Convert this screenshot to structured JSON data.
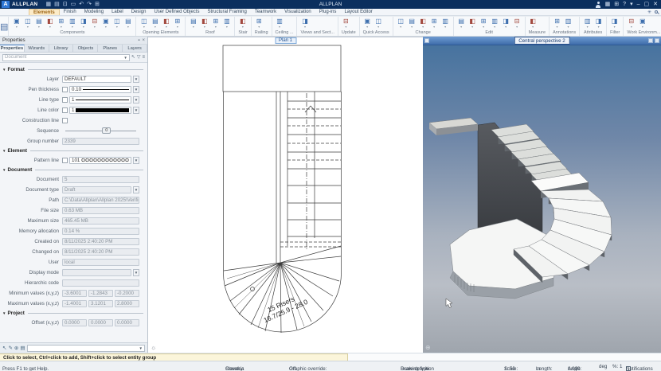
{
  "title_bar": {
    "app_name": "ALLPLAN",
    "logo_letter": "A",
    "center_title": "ALLPLAN",
    "qat_icons": [
      {
        "name": "menu-icon",
        "glyph": "▦"
      },
      {
        "name": "new-document-icon",
        "glyph": "▤"
      },
      {
        "name": "open-icon",
        "glyph": "⊡"
      },
      {
        "name": "save-icon",
        "glyph": "▭"
      },
      {
        "name": "undo-icon",
        "glyph": "↶"
      },
      {
        "name": "redo-icon",
        "glyph": "↷"
      },
      {
        "name": "print-icon",
        "glyph": "⊞"
      }
    ],
    "window_icons": {
      "apps": "▦",
      "cart": "⊞",
      "help": "?",
      "help_caret": "▾",
      "minimize": "–",
      "restore": "▢",
      "close": "✕"
    }
  },
  "ribbon": {
    "active_tab": "Elements",
    "tabs": [
      "Elements",
      "Finish",
      "Modeling",
      "Label",
      "Design",
      "User Defined Objects",
      "Structural Framing",
      "Teamwork",
      "Visualization",
      "Plug-ins",
      "Layout Editor"
    ],
    "groups": [
      {
        "label": "Components",
        "n": 11
      },
      {
        "label": "Opening Elements",
        "n": 4
      },
      {
        "label": "Roof",
        "n": 4
      },
      {
        "label": "Stair",
        "n": 1
      },
      {
        "label": "Railing",
        "n": 1
      },
      {
        "label": "Ceiling ...",
        "n": 1
      },
      {
        "label": "Views and Sect...",
        "n": 1
      },
      {
        "label": "Update",
        "n": 1
      },
      {
        "label": "Quick Access",
        "n": 2
      },
      {
        "label": "Change",
        "n": 5
      },
      {
        "label": "Edit",
        "n": 6
      },
      {
        "label": "Measure",
        "n": 1
      },
      {
        "label": "Annotations",
        "n": 2
      },
      {
        "label": "Attributes",
        "n": 2
      },
      {
        "label": "Filter",
        "n": 1
      },
      {
        "label": "Work Environm...",
        "n": 2
      }
    ]
  },
  "panel": {
    "title": "Properties",
    "tabs": [
      "Properties",
      "Wizards",
      "Library",
      "Objects",
      "Planes",
      "Layers"
    ],
    "active_tab": "Properties",
    "filter_placeholder": "Document",
    "sections": {
      "format": {
        "title": "Format",
        "layer_label": "Layer",
        "layer_value": "DEFAULT",
        "pen_label": "Pen thickness",
        "pen_value": "0.10",
        "linetype_label": "Line type",
        "linetype_value": "1",
        "linecolor_label": "Line color",
        "linecolor_value": "1",
        "construction_label": "Construction line",
        "sequence_label": "Sequence",
        "sequence_value": "0",
        "group_label": "Group number",
        "group_value": "2339"
      },
      "element": {
        "title": "Element",
        "pattern_label": "Pattern line",
        "pattern_value": "101"
      },
      "document": {
        "title": "Document",
        "rows": [
          {
            "label": "Document",
            "value": "5"
          },
          {
            "label": "Document type",
            "value": "Draft",
            "kind": "select"
          },
          {
            "label": "Path",
            "value": "C:\\Data\\Allplan\\Allplan 2025\\Verification"
          },
          {
            "label": "File size",
            "value": "0.63 MB"
          },
          {
            "label": "Maximum size",
            "value": "465.45 MB"
          },
          {
            "label": "Memory allocation",
            "value": "0.14 %"
          },
          {
            "label": "Created on",
            "value": "8/11/2025 2:40:20 PM"
          },
          {
            "label": "Changed on",
            "value": "8/11/2025 2:40:20 PM"
          },
          {
            "label": "User",
            "value": "local"
          },
          {
            "label": "Display mode",
            "value": "",
            "kind": "select"
          },
          {
            "label": "Hierarchic code",
            "value": ""
          },
          {
            "label": "Minimum values (x,y,z)",
            "kind": "triple",
            "values": [
              "-3.6001",
              "-1.2843",
              "-0.2000"
            ]
          },
          {
            "label": "Maximum values (x,y,z)",
            "kind": "triple",
            "values": [
              "-1.4001",
              "3.1201",
              "2.8000"
            ]
          }
        ]
      },
      "project": {
        "title": "Project",
        "offset_label": "Offset (x,y,z)",
        "offset_values": [
          "0.0000",
          "0.0000",
          "0.0000"
        ]
      }
    }
  },
  "plan_view": {
    "tab": "Plan 1",
    "annotation_line1": "15 Risers",
    "annotation_line2": "16.7/25.9 - 28.0"
  },
  "view3d": {
    "title": "Central perspective 2"
  },
  "prompt_bar": {
    "text": "Click to select, Ctrl+click to add, Shift+click to select entity group"
  },
  "status_bar": {
    "help": "Press F1 to get Help.",
    "country_label": "Country:",
    "country": "Slovakia",
    "graphic_label": "Graphic override:",
    "graphic": "Off",
    "drawing_label": "Drawing type:",
    "drawing": "Scale definition",
    "scale_label": "Scale:",
    "scale": "1: 50",
    "length_label": "Length:",
    "length": "m",
    "angle_label": "Angle:",
    "angle": "0.000",
    "angle_unit": "deg",
    "percent": "%: 1",
    "notifications": "Notifications"
  },
  "colors": {
    "titlebar": "#0b2f5e",
    "accent_blue": "#2e77d6",
    "active_tab_bg": "#fcebc8",
    "sky_top": "#47739f",
    "sky_bottom": "#9fa5ad"
  }
}
